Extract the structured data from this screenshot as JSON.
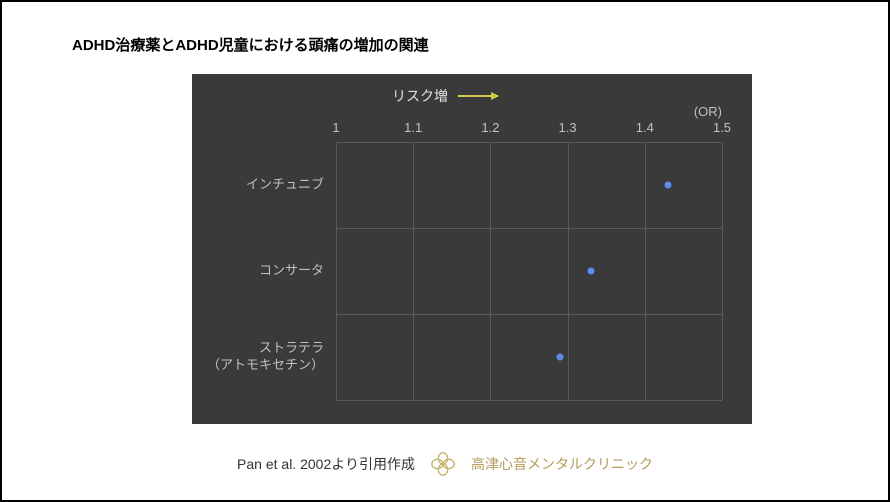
{
  "title": "ADHD治療薬とADHD児童における頭痛の増加の関連",
  "risk_label": "リスク増",
  "or_label": "(OR)",
  "citation": "Pan et al. 2002より引用作成",
  "clinic_name": "高津心音メンタルクリニック",
  "x_ticks": [
    "1",
    "1.1",
    "1.2",
    "1.3",
    "1.4",
    "1.5"
  ],
  "y_labels": [
    "インチュニブ",
    "コンサータ",
    "ストラテラ\n（アトモキセチン）"
  ],
  "chart_data": {
    "type": "scatter",
    "title": "ADHD治療薬とADHD児童における頭痛の増加の関連",
    "xlabel": "OR",
    "ylabel": "",
    "xlim": [
      1.0,
      1.5
    ],
    "x_ticks": [
      1.0,
      1.1,
      1.2,
      1.3,
      1.4,
      1.5
    ],
    "annotation": "リスク増 →",
    "categories": [
      "インチュニブ",
      "コンサータ",
      "ストラテラ（アトモキセチン）"
    ],
    "values": [
      1.43,
      1.33,
      1.29
    ]
  }
}
